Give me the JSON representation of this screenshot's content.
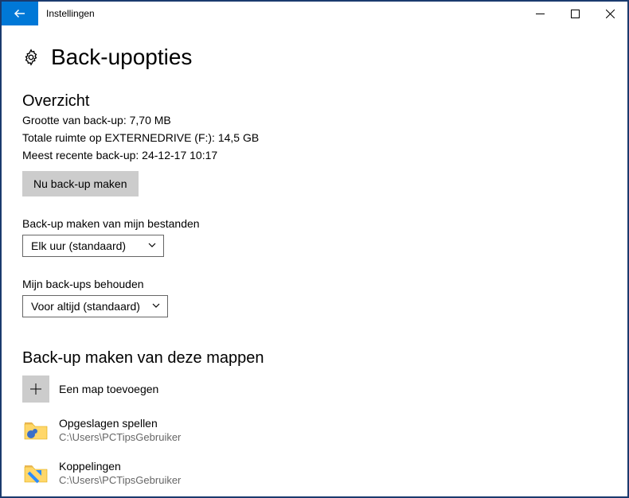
{
  "window": {
    "title": "Instellingen"
  },
  "page": {
    "title": "Back-upopties"
  },
  "overview": {
    "heading": "Overzicht",
    "size_line": "Grootte van back-up: 7,70 MB",
    "space_line": "Totale ruimte op EXTERNEDRIVE (F:): 14,5 GB",
    "last_backup_line": "Meest recente back-up: 24-12-17 10:17",
    "backup_now_label": "Nu back-up maken"
  },
  "frequency": {
    "label": "Back-up maken van mijn bestanden",
    "value": "Elk uur (standaard)"
  },
  "retention": {
    "label": "Mijn back-ups behouden",
    "value": "Voor altijd (standaard)"
  },
  "folders": {
    "heading": "Back-up maken van deze mappen",
    "add_label": "Een map toevoegen",
    "items": [
      {
        "name": "Opgeslagen spellen",
        "path": "C:\\Users\\PCTipsGebruiker"
      },
      {
        "name": "Koppelingen",
        "path": "C:\\Users\\PCTipsGebruiker"
      }
    ]
  }
}
